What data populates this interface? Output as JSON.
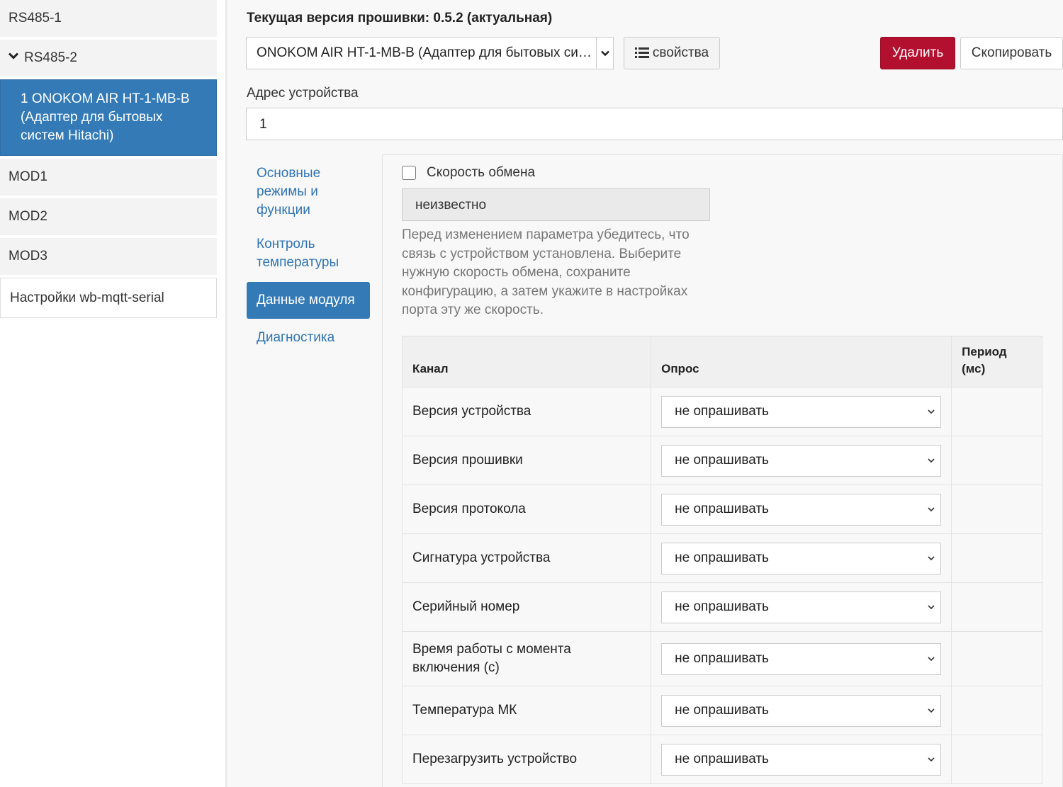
{
  "sidebar": {
    "items": [
      {
        "label": "RS485-1"
      },
      {
        "label": "RS485-2"
      },
      {
        "label": "1 ONOKOM AIR HT-1-MB-B (Адаптер для бытовых систем Hitachi)"
      },
      {
        "label": "MOD1"
      },
      {
        "label": "MOD2"
      },
      {
        "label": "MOD3"
      },
      {
        "label": "Настройки wb-mqtt-serial"
      }
    ]
  },
  "header": {
    "firmware": "Текущая версия прошивки: 0.5.2 (актуальная)",
    "device_select": "ONOKOM AIR HT-1-MB-B (Адаптер для бытовых систем Hitachi)",
    "props_label": "свойства",
    "delete_label": "Удалить",
    "copy_label": "Скопировать",
    "address_label": "Адрес устройства",
    "address_value": "1"
  },
  "pills": [
    {
      "label": "Основные режимы и функции"
    },
    {
      "label": "Контроль температуры"
    },
    {
      "label": "Данные модуля"
    },
    {
      "label": "Диагностика"
    }
  ],
  "content": {
    "speed_label": "Скорость обмена",
    "speed_value": "неизвестно",
    "help": "Перед изменением параметра убедитесь, что связь с устройством установлена. Выберите нужную скорость обмена, сохраните конфигурацию, а затем укажите в настройках порта эту же скорость.",
    "table": {
      "headers": [
        "Канал",
        "Опрос",
        "Период (мс)"
      ],
      "rows": [
        {
          "channel": "Версия устройства",
          "poll": "не опрашивать"
        },
        {
          "channel": "Версия прошивки",
          "poll": "не опрашивать"
        },
        {
          "channel": "Версия протокола",
          "poll": "не опрашивать"
        },
        {
          "channel": "Сигнатура устройства",
          "poll": "не опрашивать"
        },
        {
          "channel": "Серийный номер",
          "poll": "не опрашивать"
        },
        {
          "channel": "Время работы с момента включения (с)",
          "poll": "не опрашивать"
        },
        {
          "channel": "Температура МК",
          "poll": "не опрашивать"
        },
        {
          "channel": "Перезагрузить устройство",
          "poll": "не опрашивать"
        }
      ]
    }
  },
  "colors": {
    "primary": "#337ab7",
    "danger": "#b3102f",
    "link": "#2e74b5"
  }
}
